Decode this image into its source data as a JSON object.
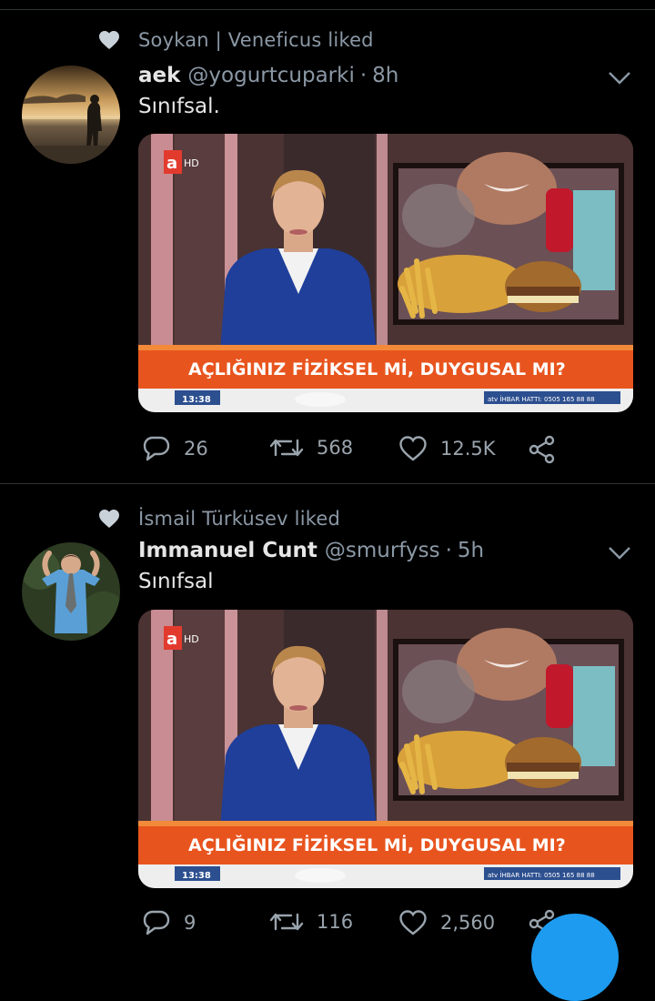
{
  "tweets": [
    {
      "liked_by": "Soykan | Veneficus liked",
      "name": "aek",
      "handle": "@yogurtcuparki",
      "time": "8h",
      "text": "Sınıfsal.",
      "media": {
        "banner": "AÇLIĞINIZ FİZİKSEL Mİ, DUYGUSAL MI?",
        "clock": "13:38",
        "logo": "a",
        "logo_hd": "HD",
        "hotline": "atv İHBAR HATTI: 0505 165 88 88"
      },
      "stats": {
        "replies": "26",
        "retweets": "568",
        "likes": "12.5K"
      }
    },
    {
      "liked_by": "İsmail Türküsev liked",
      "name": "Immanuel Cunt",
      "handle": "@smurfyss",
      "time": "5h",
      "text": "Sınıfsal",
      "media": {
        "banner": "AÇLIĞINIZ FİZİKSEL Mİ, DUYGUSAL MI?",
        "clock": "13:38",
        "logo": "a",
        "logo_hd": "HD",
        "hotline": "atv İHBAR HATTI: 0505 165 88 88"
      },
      "stats": {
        "replies": "9",
        "retweets": "116",
        "likes": "2,560"
      }
    }
  ],
  "colors": {
    "accent": "#1d9bf0",
    "muted": "#8b98a5",
    "banner": "#e8541e"
  }
}
